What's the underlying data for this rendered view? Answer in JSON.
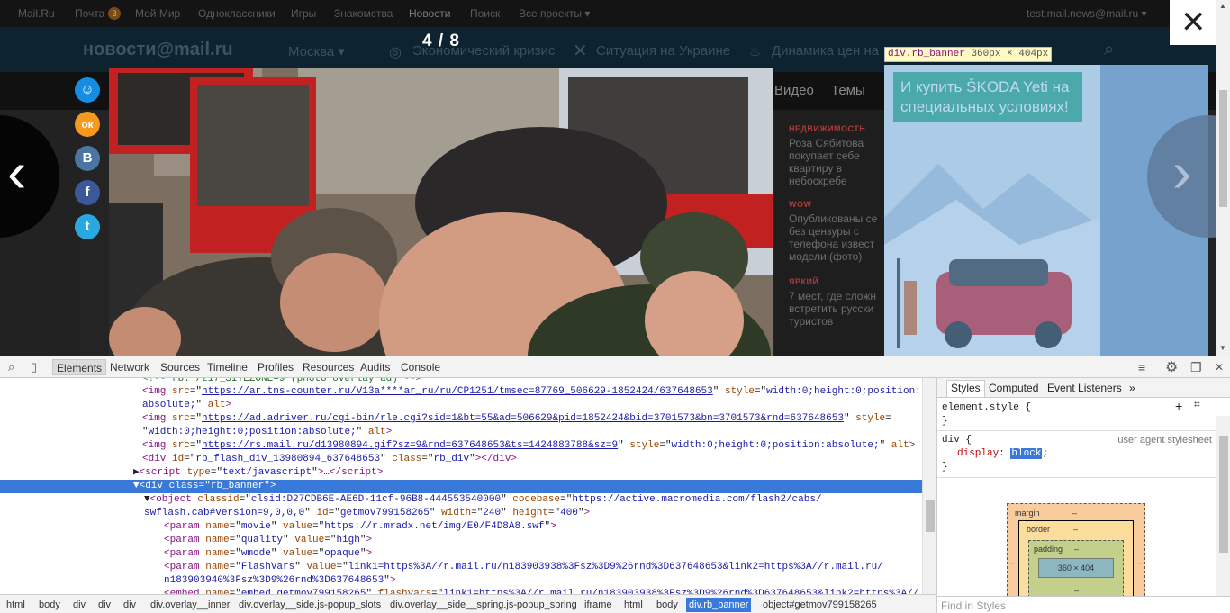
{
  "site": {
    "top_links": [
      "Mail.Ru",
      "Почта",
      "Мой Мир",
      "Одноклассники",
      "Игры",
      "Знакомства",
      "Новости",
      "Поиск",
      "Все проекты ▾"
    ],
    "mail_badge": "3",
    "account": "test.mail.news@mail.ru ▾",
    "logo": "новости@mail.ru",
    "city": "Москва ▾",
    "topics": [
      "Экономический кризис",
      "Ситуация на Украине",
      "Динамика цен на"
    ],
    "subnav": [
      "Видео",
      "Темы"
    ],
    "side_news": [
      {
        "caption": "НЕДВИЖИМОСТЬ",
        "text": "Роза Сябитова покупает себе квартиру в небоскребе"
      },
      {
        "caption": "WOW",
        "text": "Опубликованы се без цензуры с телефона извест модели (фото)"
      },
      {
        "caption": "ЯРКИЙ",
        "text": "7 мест, где сложн встретить русски туристов"
      }
    ]
  },
  "overlay": {
    "counter": "4 / 8",
    "prev": "‹",
    "next": "›",
    "close": "✕",
    "share": [
      {
        "name": "mymail",
        "glyph": "☺",
        "color": "#168de2"
      },
      {
        "name": "odnoklassniki",
        "glyph": "ок",
        "color": "#f59a1e"
      },
      {
        "name": "vkontakte",
        "glyph": "В",
        "color": "#4c75a3"
      },
      {
        "name": "facebook",
        "glyph": "f",
        "color": "#3b5998"
      },
      {
        "name": "twitter",
        "glyph": "t",
        "color": "#2aa9e0"
      }
    ]
  },
  "banner": {
    "tip_tag": "div.rb_banner",
    "tip_size": "360px × 404px",
    "text": "И купить ŠKODA Yeti на специальных условиях!"
  },
  "devtools": {
    "tabs": [
      "Elements",
      "Network",
      "Sources",
      "Timeline",
      "Profiles",
      "Resources",
      "Audits",
      "Console"
    ],
    "active_tab": "Elements",
    "breadcrumbs": [
      "html",
      "body",
      "div",
      "div",
      "div",
      "div.overlay__inner",
      "div.overlay__side.js-popup_slots",
      "div.overlay__side__spring.js-popup_spring",
      "iframe",
      "html",
      "body",
      "div.rb_banner",
      "object#getmov799158265"
    ],
    "active_crumb": "div.rb_banner",
    "styles_tabs": [
      "Styles",
      "Computed",
      "Event Listeners",
      "»"
    ],
    "element_style": "element.style {",
    "rule_selector": "div {",
    "rule_source": "user agent stylesheet",
    "rule_prop": "display",
    "rule_value": "block",
    "box_margin": "margin",
    "box_border": "border",
    "box_padding": "padding",
    "box_content": "360 × 404",
    "box_dash": "–",
    "find_placeholder": "Find in Styles"
  }
}
